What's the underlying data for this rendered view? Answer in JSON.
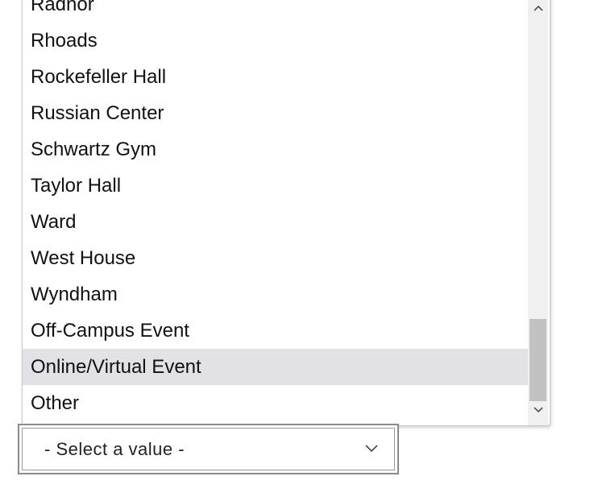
{
  "dropdown": {
    "options": [
      "Radnor",
      "Rhoads",
      "Rockefeller Hall",
      "Russian Center",
      "Schwartz Gym",
      "Taylor Hall",
      "Ward",
      "West House",
      "Wyndham",
      "Off-Campus Event",
      "Online/Virtual Event",
      "Other"
    ],
    "highlighted_option": "Online/Virtual Event",
    "scroll_position": 1.0
  },
  "select": {
    "current_value": "- Select a value -"
  },
  "colors": {
    "highlight_background": "#e1e1e6",
    "scrollbar_track": "#f0f0f0",
    "scrollbar_thumb": "#c1c1c1"
  },
  "icons": {
    "scroll_up": "chevron-up-icon",
    "scroll_down": "chevron-down-icon",
    "select_arrow": "chevron-down-icon"
  }
}
